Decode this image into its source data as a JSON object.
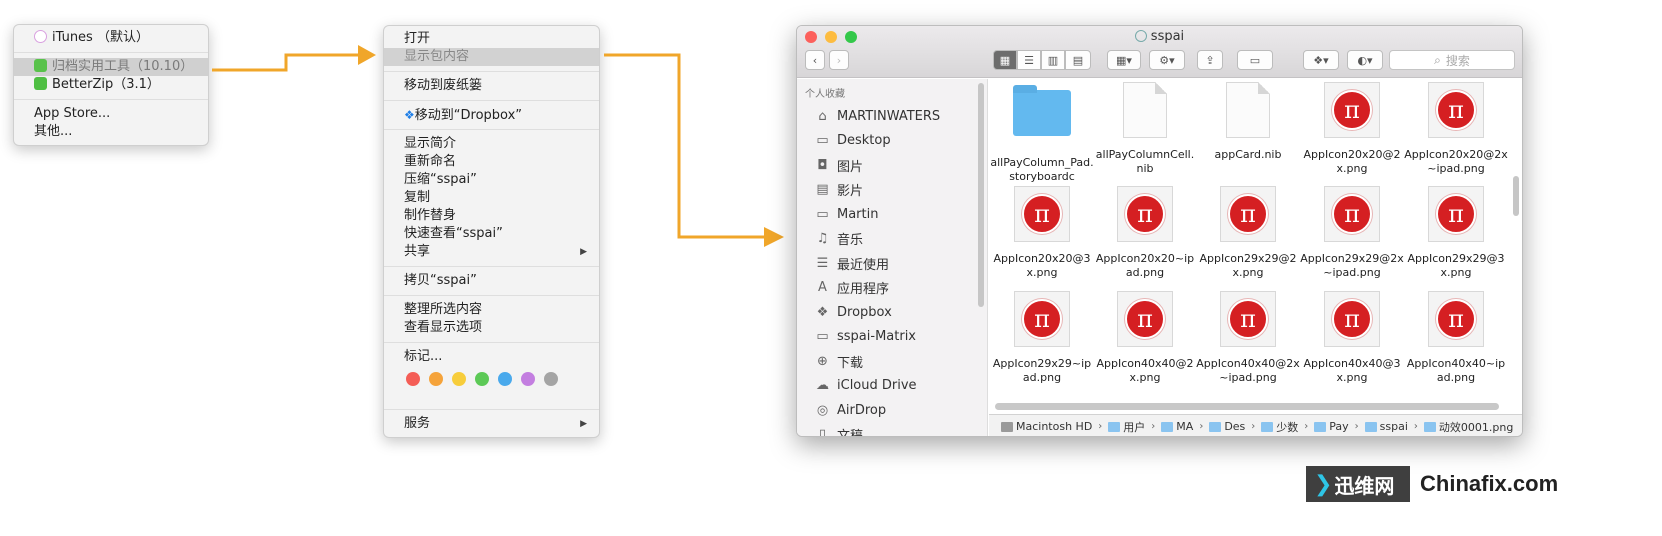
{
  "open_with_menu": {
    "items": [
      {
        "label": "iTunes （默认）",
        "icon": "itunes-icon",
        "color": "#d9a0e0"
      },
      {
        "label": "归档实用工具（10.10）",
        "icon": "archive-utility-icon",
        "color": "#58c24a",
        "highlighted": true
      },
      {
        "label": "BetterZip（3.1）",
        "icon": "betterzip-icon",
        "color": "#4fbf43"
      }
    ],
    "extra": [
      "App Store...",
      "其他..."
    ]
  },
  "context_menu": {
    "group1": [
      "打开",
      "显示包内容"
    ],
    "group2": [
      "移动到废纸篓"
    ],
    "dropbox": "移动到“Dropbox”",
    "group3": [
      "显示简介",
      "重新命名",
      "压缩“sspai”",
      "复制",
      "制作替身",
      "快速查看“sspai”",
      "共享"
    ],
    "group4": [
      "拷贝“sspai”"
    ],
    "group5": [
      "整理所选内容",
      "查看显示选项"
    ],
    "tags_label": "标记...",
    "tag_colors": [
      "#f45d56",
      "#f5a33a",
      "#f7cd3b",
      "#5cc956",
      "#49a9ec",
      "#c37ee0",
      "#a4a4a4"
    ],
    "services": "服务"
  },
  "finder": {
    "title": "sspai",
    "search_placeholder": "搜索",
    "sidebar_header": "个人收藏",
    "sidebar": [
      {
        "label": "MARTINWATERS",
        "icon": "home-icon"
      },
      {
        "label": "Desktop",
        "icon": "desktop-icon"
      },
      {
        "label": "图片",
        "icon": "camera-icon"
      },
      {
        "label": "影片",
        "icon": "film-icon"
      },
      {
        "label": "Martin",
        "icon": "folder-icon"
      },
      {
        "label": "音乐",
        "icon": "music-icon"
      },
      {
        "label": "最近使用",
        "icon": "recents-icon"
      },
      {
        "label": "应用程序",
        "icon": "applications-icon"
      },
      {
        "label": "Dropbox",
        "icon": "dropbox-icon"
      },
      {
        "label": "sspai-Matrix",
        "icon": "folder-icon"
      },
      {
        "label": "下载",
        "icon": "download-icon"
      },
      {
        "label": "iCloud Drive",
        "icon": "cloud-icon"
      },
      {
        "label": "AirDrop",
        "icon": "airdrop-icon"
      },
      {
        "label": "文稿",
        "icon": "documents-icon"
      }
    ],
    "files": [
      {
        "name": "allPayColumn_Pad.storyboardc",
        "kind": "folder"
      },
      {
        "name": "allPayColumnCell.nib",
        "kind": "doc"
      },
      {
        "name": "appCard.nib",
        "kind": "doc"
      },
      {
        "name": "AppIcon20x20@2x.png",
        "kind": "pi"
      },
      {
        "name": "AppIcon20x20@2x~ipad.png",
        "kind": "pi"
      },
      {
        "name": "AppIcon20x20@3x.png",
        "kind": "pi"
      },
      {
        "name": "AppIcon20x20~ipad.png",
        "kind": "pi"
      },
      {
        "name": "AppIcon29x29@2x.png",
        "kind": "pi"
      },
      {
        "name": "AppIcon29x29@2x~ipad.png",
        "kind": "pi"
      },
      {
        "name": "AppIcon29x29@3x.png",
        "kind": "pi"
      },
      {
        "name": "AppIcon29x29~ipad.png",
        "kind": "pi"
      },
      {
        "name": "AppIcon40x40@2x.png",
        "kind": "pi"
      },
      {
        "name": "AppIcon40x40@2x~ipad.png",
        "kind": "pi"
      },
      {
        "name": "AppIcon40x40@3x.png",
        "kind": "pi"
      },
      {
        "name": "AppIcon40x40~ipad.png",
        "kind": "pi"
      }
    ],
    "pi_glyph": "π",
    "path": [
      "Macintosh HD",
      "用户",
      "MA",
      "Des",
      "少数",
      "Pay",
      "sspai",
      "动效0001.png"
    ]
  },
  "watermark": {
    "left": "迅维网",
    "right": "Chinafix.com"
  }
}
